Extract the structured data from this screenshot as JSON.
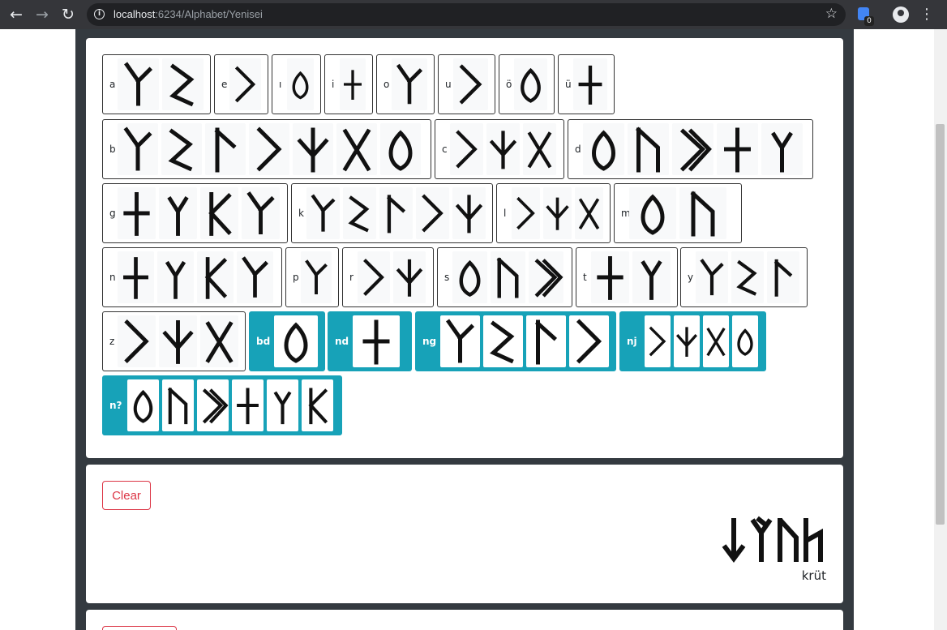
{
  "browser": {
    "url_host": "localhost",
    "url_rest": ":6234/Alphabet/Yenisei",
    "extension_badge": "0",
    "icons": [
      "back-icon",
      "forward-icon",
      "reload-icon",
      "info-icon",
      "star-icon",
      "extension-icon",
      "profile-icon",
      "menu-icon"
    ]
  },
  "alphabet": {
    "groups": [
      {
        "label": "a",
        "runes": 2
      },
      {
        "label": "e",
        "runes": 1
      },
      {
        "label": "ı",
        "runes": 1
      },
      {
        "label": "i",
        "runes": 1
      },
      {
        "label": "o",
        "runes": 1
      },
      {
        "label": "u",
        "runes": 1
      },
      {
        "label": "ö",
        "runes": 1
      },
      {
        "label": "ü",
        "runes": 1
      },
      {
        "label": "b",
        "runes": 7
      },
      {
        "label": "c",
        "runes": 3
      },
      {
        "label": "d",
        "runes": 5
      },
      {
        "label": "g",
        "runes": 4
      },
      {
        "label": "k",
        "runes": 5
      },
      {
        "label": "l",
        "runes": 3
      },
      {
        "label": "m",
        "runes": 2
      },
      {
        "label": "n",
        "runes": 4
      },
      {
        "label": "p",
        "runes": 1
      },
      {
        "label": "r",
        "runes": 2
      },
      {
        "label": "s",
        "runes": 3
      },
      {
        "label": "t",
        "runes": 2
      },
      {
        "label": "y",
        "runes": 3
      },
      {
        "label": "z",
        "runes": 3
      },
      {
        "label": "bd",
        "runes": 1
      },
      {
        "label": "nd",
        "runes": 1
      },
      {
        "label": "ng",
        "runes": 4
      },
      {
        "label": "nj",
        "runes": 4
      },
      {
        "label": "n?",
        "runes": 6
      }
    ]
  },
  "output": {
    "clear_label": "Clear",
    "transliteration": "krüt"
  }
}
